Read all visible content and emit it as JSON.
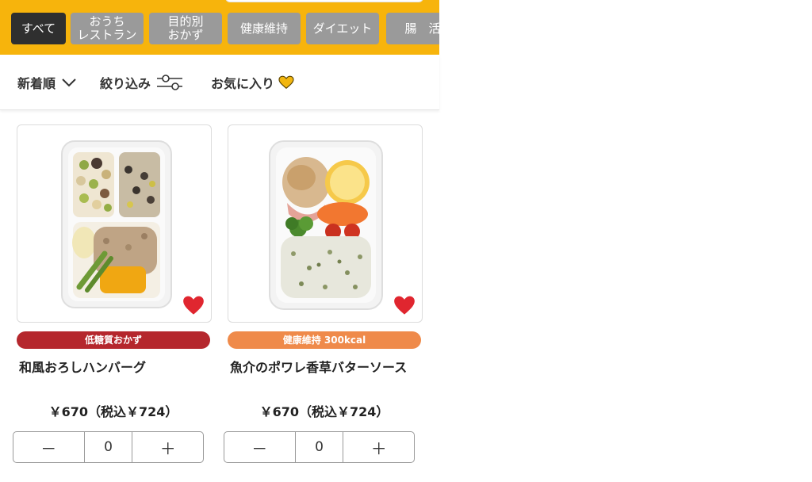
{
  "categories": [
    {
      "lines": [
        "すべて"
      ],
      "active": true
    },
    {
      "lines": [
        "おうち",
        "レストラン"
      ],
      "active": false
    },
    {
      "lines": [
        "目的別",
        "おかず"
      ],
      "active": false
    },
    {
      "lines": [
        "健康維持"
      ],
      "active": false
    },
    {
      "lines": [
        "ダイエット"
      ],
      "active": false
    },
    {
      "lines": [
        "腸　活"
      ],
      "active": false
    }
  ],
  "filters": {
    "sort_label": "新着順",
    "narrow_label": "絞り込み",
    "favorites_label": "お気に入り"
  },
  "products": [
    {
      "badge": "低糖質おかず",
      "badge_color": "#b5272d",
      "name": "和風おろしハンバーグ",
      "price": "￥670（税込￥724）",
      "qty_minus": "－",
      "qty_value": "0",
      "qty_plus": "＋",
      "favorite": true
    },
    {
      "badge": "健康維持 300kcal",
      "badge_color": "#ef8a4a",
      "name": "魚介のポワレ香草バターソース",
      "price": "￥670（税込￥724）",
      "qty_minus": "－",
      "qty_value": "0",
      "qty_plus": "＋",
      "favorite": true
    }
  ],
  "colors": {
    "header_bg": "#f7b40c",
    "tab_active": "#2f2f2f",
    "tab_inactive": "#9a9a9a",
    "heart": "#e0262f",
    "fav_heart": "#f2b60f"
  }
}
